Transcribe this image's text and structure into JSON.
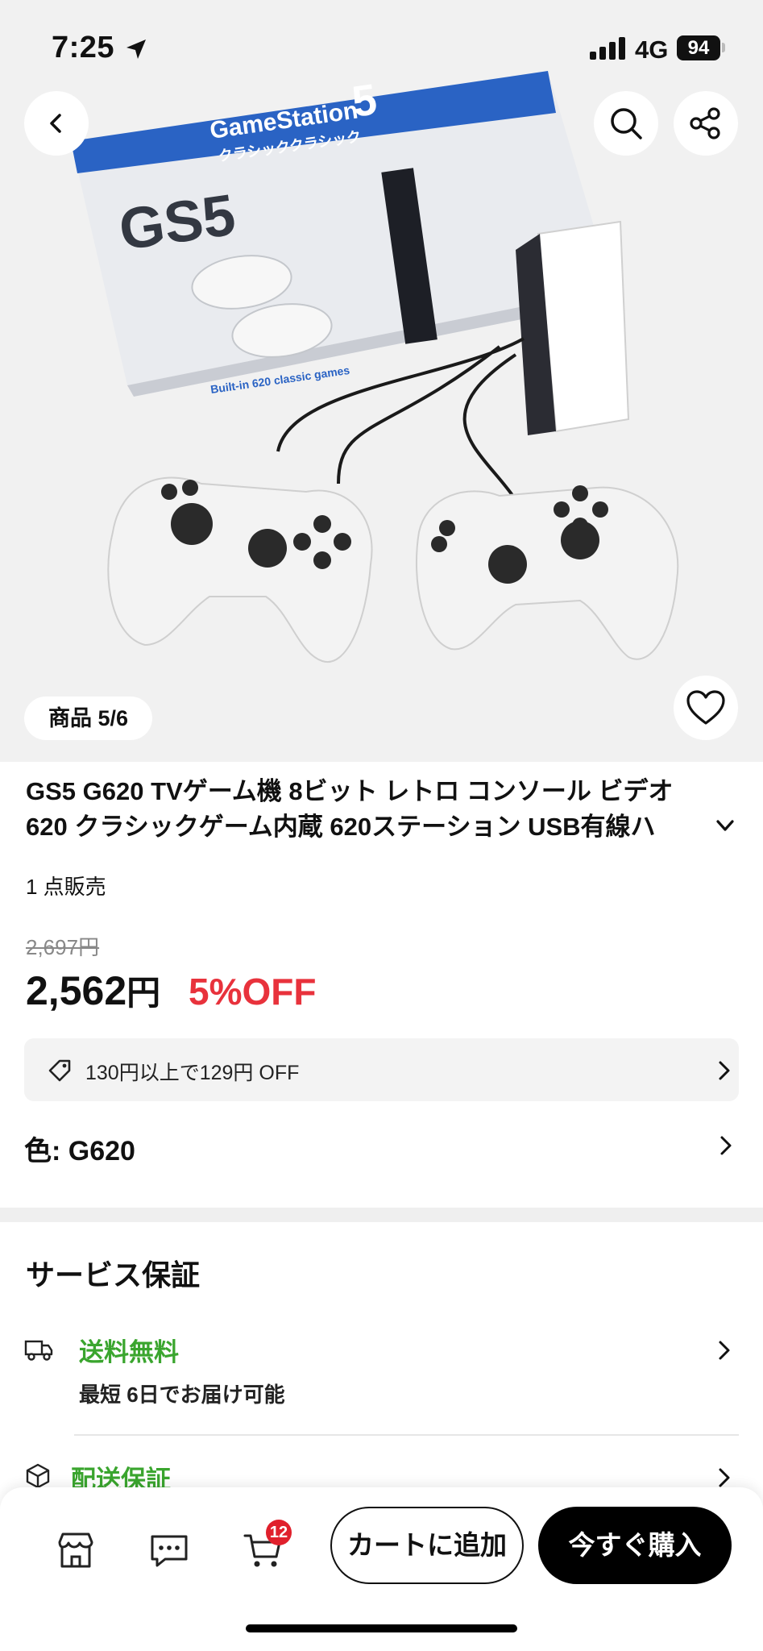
{
  "status_bar": {
    "time": "7:25",
    "network": "4G",
    "battery": "94"
  },
  "gallery": {
    "counter": "商品 5/6"
  },
  "product": {
    "title_line1": "GS5 G620 TVゲーム機 8ビット レトロ コンソール ビデオ",
    "title_line2": "620 クラシックゲーム内蔵 620ステーション USB有線ハ",
    "sold": "1 点販売",
    "original_price": "2,697円",
    "price_number": "2,562",
    "price_currency": "円",
    "discount": "5%OFF"
  },
  "box_art": {
    "brand": "GameStation",
    "brand_number": "5",
    "katakana": "クラシッククラシック",
    "logo": "GS5",
    "built_in": "Built-in 620 classic games"
  },
  "coupon": {
    "text": "130円以上で129円 OFF"
  },
  "variant": {
    "label": "色: G620"
  },
  "service": {
    "title": "サービス保証",
    "items": [
      {
        "main": "送料無料",
        "sub": "最短 6日でお届け可能"
      },
      {
        "main": "配送保証"
      }
    ]
  },
  "bottom_bar": {
    "cart_count": "12",
    "add_to_cart": "カートに追加",
    "buy_now": "今すぐ購入"
  },
  "colors": {
    "accent_red": "#e8323c",
    "accent_green": "#3aa52e",
    "box_blue": "#2a63c4"
  },
  "icons": [
    "location-arrow-icon",
    "signal-icon",
    "back-icon",
    "search-icon",
    "share-icon",
    "heart-icon",
    "chevron-down-icon",
    "tag-icon",
    "chevron-right-icon",
    "truck-icon",
    "package-icon",
    "store-icon",
    "chat-icon",
    "cart-icon"
  ]
}
